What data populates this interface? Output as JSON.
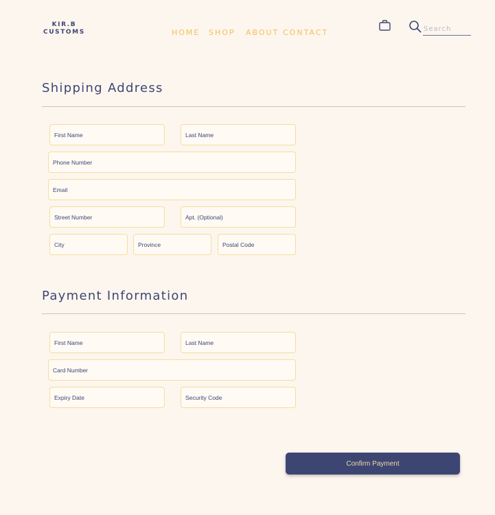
{
  "brand": {
    "line1": "KIR.B",
    "line2": "CUSTOMS"
  },
  "nav": {
    "home": "HOME",
    "shop": "SHOP",
    "about": "ABOUT",
    "contact": "CONTACT"
  },
  "header": {
    "cart_icon": "shopping-bag-icon",
    "search_icon": "search-icon",
    "search_placeholder": "Search"
  },
  "shipping": {
    "title": "Shipping Address",
    "first_name": "First Name",
    "last_name": "Last Name",
    "phone": "Phone Number",
    "email": "Email",
    "street": "Street Number",
    "apt": "Apt. (Optional)",
    "city": "City",
    "province": "Province",
    "postal": "Postal Code"
  },
  "payment": {
    "title": "Payment Information",
    "first_name": "First Name",
    "last_name": "Last Name",
    "card": "Card Number",
    "expiry": "Expiry Date",
    "security": "Security Code"
  },
  "confirm_label": "Confirm Payment",
  "colors": {
    "navy": "#3d4673",
    "gold": "#f2c053",
    "background": "#fdf6ef",
    "field_border": "#f6dc9c"
  }
}
